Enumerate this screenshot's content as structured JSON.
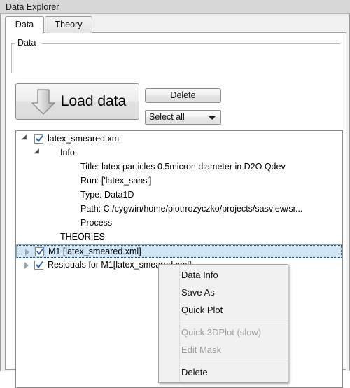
{
  "window": {
    "title": "Data Explorer"
  },
  "tabs": [
    {
      "label": "Data",
      "active": true
    },
    {
      "label": "Theory",
      "active": false
    }
  ],
  "groupbox": {
    "label": "Data"
  },
  "toolbar": {
    "load_data_label": "Load data",
    "load_data_icon": "download-arrow-icon",
    "delete_label": "Delete",
    "select_all_label": "Select all",
    "select_all_icon": "chevron-down-icon"
  },
  "tree": {
    "rows": [
      {
        "label": "latex_smeared.xml",
        "indent": 0,
        "arrow": "expanded",
        "checkbox": "checked",
        "selected": false
      },
      {
        "label": "Info",
        "indent": 1,
        "arrow": "expanded",
        "checkbox": "none",
        "selected": false
      },
      {
        "label": "Title: latex particles 0.5micron diameter in D2O Qdev",
        "indent": 2,
        "arrow": "none",
        "checkbox": "none",
        "selected": false
      },
      {
        "label": "Run: ['latex_sans']",
        "indent": 2,
        "arrow": "none",
        "checkbox": "none",
        "selected": false
      },
      {
        "label": "Type: Data1D",
        "indent": 2,
        "arrow": "none",
        "checkbox": "none",
        "selected": false
      },
      {
        "label": "Path: C:/cygwin/home/piotrrozyczko/projects/sasview/sr...",
        "indent": 2,
        "arrow": "none",
        "checkbox": "none",
        "selected": false
      },
      {
        "label": "Process",
        "indent": 2,
        "arrow": "none",
        "checkbox": "none",
        "selected": false
      },
      {
        "label": "THEORIES",
        "indent": 1,
        "arrow": "none",
        "checkbox": "none",
        "selected": false
      },
      {
        "label": "M1 [latex_smeared.xml]",
        "indent": 0,
        "arrow": "collapsed",
        "checkbox": "checked",
        "selected": true
      },
      {
        "label": "Residuals for M1[latex_smeared.xml]",
        "indent": 0,
        "arrow": "collapsed",
        "checkbox": "checked",
        "selected": false
      }
    ]
  },
  "context_menu": {
    "items": [
      {
        "label": "Data Info",
        "disabled": false,
        "type": "item"
      },
      {
        "label": "Save As",
        "disabled": false,
        "type": "item"
      },
      {
        "label": "Quick Plot",
        "disabled": false,
        "type": "item"
      },
      {
        "type": "separator"
      },
      {
        "label": "Quick 3DPlot (slow)",
        "disabled": true,
        "type": "item"
      },
      {
        "label": "Edit Mask",
        "disabled": true,
        "type": "item"
      },
      {
        "type": "separator"
      },
      {
        "label": "Delete",
        "disabled": false,
        "type": "item"
      }
    ]
  },
  "colors": {
    "selection": "#cfe6f8",
    "selection_border": "#7aa8cd",
    "checkmark": "#2361b8",
    "titlebar": "#d7d7d7"
  }
}
